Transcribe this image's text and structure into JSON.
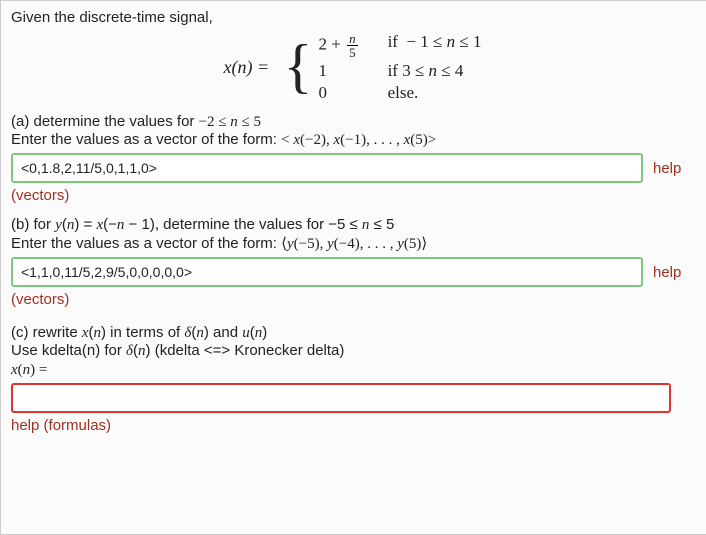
{
  "intro": "Given the discrete-time signal,",
  "piecewise": {
    "lhs": "x(n) = ",
    "cases": [
      {
        "value_html": "2 + <span class='frac'><span class='num mi'>n</span><span class='den'>5</span></span>",
        "cond": "if  − 1 ≤ n ≤ 1"
      },
      {
        "value_html": "1",
        "cond": "if 3 ≤ n ≤ 4"
      },
      {
        "value_html": "0",
        "cond": "else."
      }
    ]
  },
  "partA": {
    "label": "(a) determine the values for −2 ≤ n ≤ 5",
    "prompt_prefix": "Enter the values as a vector of the form: ",
    "prompt_math": "< x(−2), x(−1), . . . , x(5)>",
    "value": "<0,1.8,2,11/5,0,1,1,0>",
    "help": "help",
    "vectors": "(vectors)"
  },
  "partB": {
    "label_html": "(b) for <span class='mi'>y</span>(<span class='mi'>n</span>) = <span class='mi'>x</span>(−<span class='mi'>n</span> − 1), determine the values for −5 ≤ <span class='mi'>n</span> ≤ 5",
    "prompt_prefix": "Enter the values as a vector of the form: ",
    "prompt_math": "⟨y(−5), y(−4), . . . , y(5)⟩",
    "value": "<1,1,0,11/5,2,9/5,0,0,0,0,0>",
    "help": "help",
    "vectors": "(vectors)"
  },
  "partC": {
    "line1_html": "(c) rewrite <span class='mi'>x</span>(<span class='mi'>n</span>) in terms of <span class='mi'>δ</span>(<span class='mi'>n</span>) and <span class='mi'>u</span>(<span class='mi'>n</span>)",
    "line2_html": "Use kdelta(n) for <span class='mi'>δ</span>(<span class='mi'>n</span>) (kdelta <=> Kronecker delta)",
    "lhs": "x(n) =",
    "value": "",
    "help": "help (formulas)"
  }
}
